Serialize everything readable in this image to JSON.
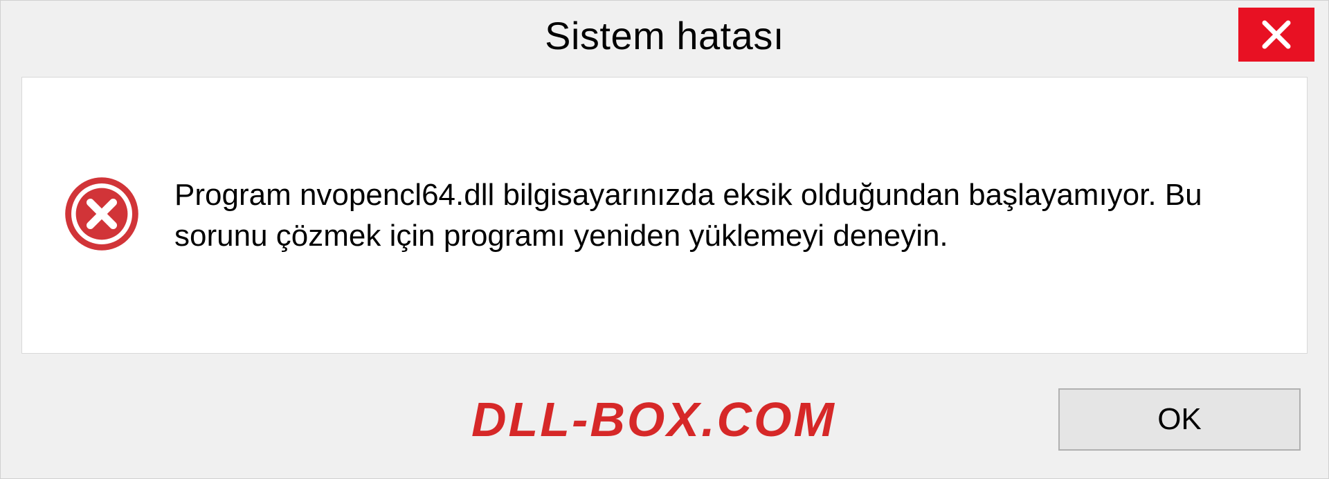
{
  "dialog": {
    "title": "Sistem hatası",
    "message": "Program nvopencl64.dll bilgisayarınızda eksik olduğundan başlayamıyor. Bu sorunu çözmek için programı yeniden yüklemeyi deneyin.",
    "ok_label": "OK"
  },
  "watermark": "DLL-BOX.COM",
  "colors": {
    "close_bg": "#e81123",
    "error_icon": "#d13438",
    "watermark": "#d62828"
  }
}
